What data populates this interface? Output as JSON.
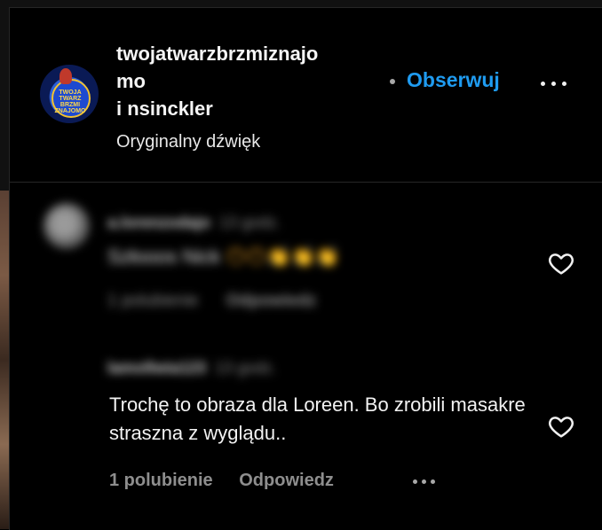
{
  "post": {
    "username_line1": "twojatwarzbrzmiznajo",
    "username_line2": "mo",
    "coauthor_prefix": "i ",
    "coauthor": "nsinckler",
    "audio": "Oryginalny dźwięk",
    "follow_label": "Obserwuj",
    "avatar_text": "TWOJA TWARZ BRZMI ZNAJOMO"
  },
  "comments": [
    {
      "username": "a.lorenzodajo",
      "time": "13 godz.",
      "text": "Szłooos Nick",
      "emoji": "😶😶👏👏👏",
      "likes": "1 polubienie",
      "reply": "Odpowiedz",
      "blurred": true
    },
    {
      "username": "lamollwia123",
      "time": "13 godz.",
      "text": "Trochę to obraza dla Loreen. Bo zrobili masakre straszna z wyglądu..",
      "likes": "1 polubienie",
      "reply": "Odpowiedz",
      "blurred": false
    }
  ],
  "icons": {
    "more": "more-horizontal-icon",
    "heart": "heart-icon"
  },
  "colors": {
    "accent": "#1f9bf0",
    "background": "#000000",
    "muted": "#8e8e8e"
  }
}
